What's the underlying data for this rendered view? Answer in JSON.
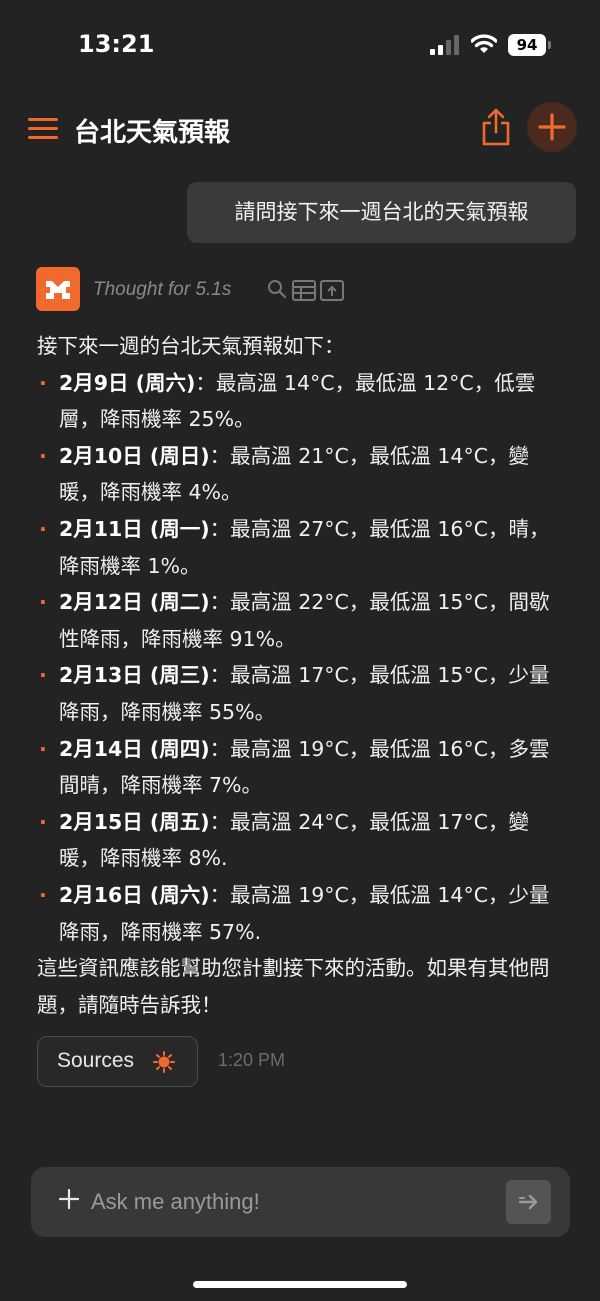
{
  "status_bar": {
    "time": "13:21",
    "battery": "94"
  },
  "header": {
    "title": "台北天氣預報"
  },
  "user_message": "請問接下來一週台北的天氣預報",
  "assistant": {
    "thought_label": "Thought for 5.1s",
    "intro": "接下來一週的台北天氣預報如下：",
    "forecast": [
      {
        "day": "2月9日 (周六)",
        "text": "：最高溫 14°C，最低溫 12°C，低雲層，降雨機率 25%。"
      },
      {
        "day": "2月10日 (周日)",
        "text": "：最高溫 21°C，最低溫 14°C，變暖，降雨機率 4%。"
      },
      {
        "day": "2月11日 (周一)",
        "text": "：最高溫 27°C，最低溫 16°C，晴，降雨機率 1%。"
      },
      {
        "day": "2月12日 (周二)",
        "text": "：最高溫 22°C，最低溫 15°C，間歇性降雨，降雨機率 91%。"
      },
      {
        "day": "2月13日 (周三)",
        "text": "：最高溫 17°C，最低溫 15°C，少量降雨，降雨機率 55%。"
      },
      {
        "day": "2月14日 (周四)",
        "text": "：最高溫 19°C，最低溫 16°C，多雲間晴，降雨機率 7%。"
      },
      {
        "day": "2月15日 (周五)",
        "text": "：最高溫 24°C，最低溫 17°C，變暖，降雨機率 8%."
      },
      {
        "day": "2月16日 (周六)",
        "text": "：最高溫 19°C，最低溫 14°C，少量降雨，降雨機率 57%."
      }
    ],
    "outro": "這些資訊應該能幫助您計劃接下來的活動。如果有其他問題，請隨時告訴我！",
    "sources_label": "Sources",
    "time": "1:20 PM"
  },
  "input": {
    "placeholder": "Ask me anything!"
  },
  "colors": {
    "accent": "#f06a2e",
    "background": "#232323",
    "bubble": "#3a3a3a"
  }
}
